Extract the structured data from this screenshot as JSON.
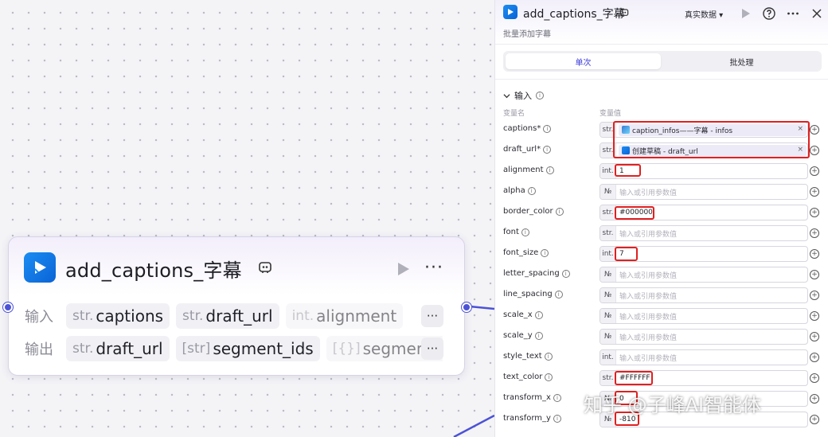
{
  "node": {
    "title": "add_captions_字幕",
    "input_label": "输入",
    "output_label": "输出",
    "inputs": [
      {
        "type": "str.",
        "name": "captions"
      },
      {
        "type": "str.",
        "name": "draft_url"
      },
      {
        "type": "int.",
        "name": "alignment"
      }
    ],
    "outputs": [
      {
        "type": "str.",
        "name": "draft_url"
      },
      {
        "type": "[str]",
        "name": "segment_ids"
      },
      {
        "type": "[{}]",
        "name": "segment_"
      }
    ],
    "more": "···"
  },
  "panel": {
    "title": "add_captions_字幕",
    "subtitle": "批量添加字幕",
    "data_mode": "真实数据 ▾",
    "tabs": {
      "single": "单次",
      "batch": "批处理"
    },
    "section": "输入",
    "col_name": "变量名",
    "col_value": "变量值",
    "placeholder": "输入或引用参数值",
    "params": [
      {
        "name": "captions*",
        "type": "str.",
        "ref": "caption_infos——字幕 - infos",
        "ref_icon": "image"
      },
      {
        "name": "draft_url*",
        "type": "str.",
        "ref": "创建草稿 - draft_url",
        "ref_icon": "app"
      },
      {
        "name": "alignment",
        "type": "int.",
        "value": "1"
      },
      {
        "name": "alpha",
        "type": "№",
        "value": ""
      },
      {
        "name": "border_color",
        "type": "str.",
        "value": "#000000"
      },
      {
        "name": "font",
        "type": "str.",
        "value": ""
      },
      {
        "name": "font_size",
        "type": "int.",
        "value": "7"
      },
      {
        "name": "letter_spacing",
        "type": "№",
        "value": ""
      },
      {
        "name": "line_spacing",
        "type": "№",
        "value": ""
      },
      {
        "name": "scale_x",
        "type": "№",
        "value": ""
      },
      {
        "name": "scale_y",
        "type": "№",
        "value": ""
      },
      {
        "name": "style_text",
        "type": "int.",
        "value": ""
      },
      {
        "name": "text_color",
        "type": "str.",
        "value": "#FFFFFF"
      },
      {
        "name": "transform_x",
        "type": "№",
        "value": "0"
      },
      {
        "name": "transform_y",
        "type": "№",
        "value": "-810"
      }
    ]
  },
  "watermark": "知乎 @子峰AI智能体",
  "colors": {
    "accent": "#3c3cd8",
    "port": "#4c52d6",
    "highlight": "#e02020",
    "brand": "#0a63d6"
  }
}
